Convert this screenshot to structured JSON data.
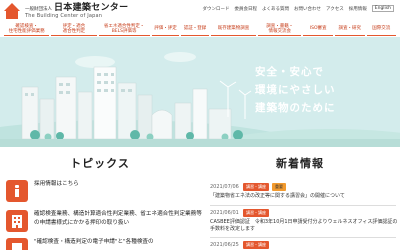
{
  "header": {
    "logo_small": "一般財団法人",
    "logo_name": "日本建築センター",
    "logo_en": "The Building Center of Japan",
    "links": [
      "ダウンロード",
      "委員会日程",
      "よくある質問",
      "お問い合わせ",
      "アクセス",
      "採用情報"
    ],
    "lang_label": "English"
  },
  "mainnav": {
    "items": [
      "確認検査・\n住宅性能評価業務",
      "評定・適合\n適合性判定",
      "省エネ適合性判定・\nBELS評価等",
      "評価・評定",
      "認証・登録",
      "既存建築物調査",
      "調査・書籍・\n情報交流会",
      "ISO審査",
      "調査・研究",
      "国際交流"
    ]
  },
  "hero": {
    "lines": [
      "安全・安心で",
      "環境にやさしい",
      "建築物のために"
    ],
    "bg_color": "#d3ecec"
  },
  "topics": {
    "title": "トピックス",
    "items": [
      "採用情報はこちら",
      "確認検査業務、構造計算適合性判定業務、省エネ適合性判定業務等の申請書様式にかかる押印の取り扱い",
      "\"確認検査・構造判定の電子申請\"と\"各種検査の"
    ]
  },
  "news": {
    "title": "新着情報",
    "items": [
      {
        "date": "2021/07/06",
        "tags": [
          "講習・講座",
          "重要"
        ],
        "text": "「建築物省エネ法の改正等に関する講習会」の開催について"
      },
      {
        "date": "2021/06/01",
        "tags": [
          "講習・講座"
        ],
        "text": "CASBEE評価認証　令和3年10月1日申請受付分よりウェルネスオフィス評価認証の手数料を改定します"
      },
      {
        "date": "2021/06/25",
        "tags": [
          "講習・講座"
        ],
        "text": ""
      }
    ]
  },
  "colors": {
    "accent": "#e4572e",
    "accent_dark": "#c63b17",
    "tag_orange": "#f29a2e"
  }
}
